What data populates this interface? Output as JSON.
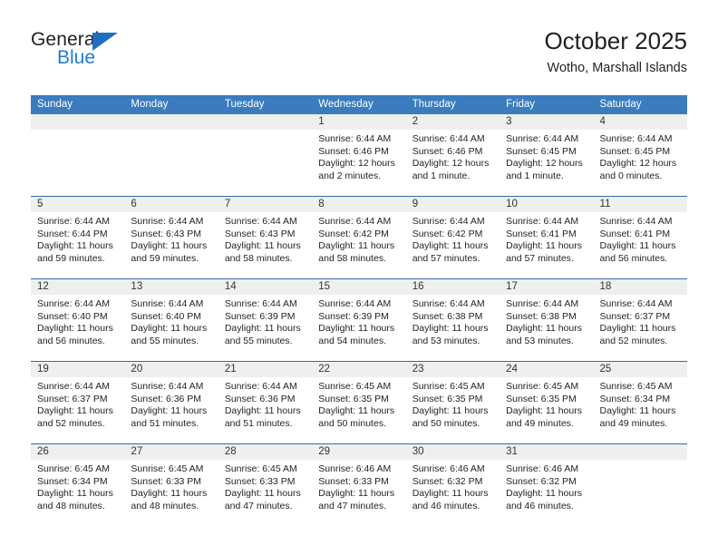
{
  "brand": {
    "name_top": "General",
    "name_bottom": "Blue",
    "accent_color": "#1f7bd4"
  },
  "header": {
    "title": "October 2025",
    "subtitle": "Wotho, Marshall Islands"
  },
  "calendar": {
    "header_background": "#3a7cbe",
    "day_band_background": "#efefef",
    "row_border_color": "#2e6daf",
    "weekdays": [
      "Sunday",
      "Monday",
      "Tuesday",
      "Wednesday",
      "Thursday",
      "Friday",
      "Saturday"
    ],
    "labels": {
      "sunrise": "Sunrise:",
      "sunset": "Sunset:",
      "daylight": "Daylight:"
    },
    "weeks": [
      [
        {
          "day": "",
          "empty": true
        },
        {
          "day": "",
          "empty": true
        },
        {
          "day": "",
          "empty": true
        },
        {
          "day": "1",
          "sunrise": "Sunrise: 6:44 AM",
          "sunset": "Sunset: 6:46 PM",
          "daylight": "Daylight: 12 hours and 2 minutes."
        },
        {
          "day": "2",
          "sunrise": "Sunrise: 6:44 AM",
          "sunset": "Sunset: 6:46 PM",
          "daylight": "Daylight: 12 hours and 1 minute."
        },
        {
          "day": "3",
          "sunrise": "Sunrise: 6:44 AM",
          "sunset": "Sunset: 6:45 PM",
          "daylight": "Daylight: 12 hours and 1 minute."
        },
        {
          "day": "4",
          "sunrise": "Sunrise: 6:44 AM",
          "sunset": "Sunset: 6:45 PM",
          "daylight": "Daylight: 12 hours and 0 minutes."
        }
      ],
      [
        {
          "day": "5",
          "sunrise": "Sunrise: 6:44 AM",
          "sunset": "Sunset: 6:44 PM",
          "daylight": "Daylight: 11 hours and 59 minutes."
        },
        {
          "day": "6",
          "sunrise": "Sunrise: 6:44 AM",
          "sunset": "Sunset: 6:43 PM",
          "daylight": "Daylight: 11 hours and 59 minutes."
        },
        {
          "day": "7",
          "sunrise": "Sunrise: 6:44 AM",
          "sunset": "Sunset: 6:43 PM",
          "daylight": "Daylight: 11 hours and 58 minutes."
        },
        {
          "day": "8",
          "sunrise": "Sunrise: 6:44 AM",
          "sunset": "Sunset: 6:42 PM",
          "daylight": "Daylight: 11 hours and 58 minutes."
        },
        {
          "day": "9",
          "sunrise": "Sunrise: 6:44 AM",
          "sunset": "Sunset: 6:42 PM",
          "daylight": "Daylight: 11 hours and 57 minutes."
        },
        {
          "day": "10",
          "sunrise": "Sunrise: 6:44 AM",
          "sunset": "Sunset: 6:41 PM",
          "daylight": "Daylight: 11 hours and 57 minutes."
        },
        {
          "day": "11",
          "sunrise": "Sunrise: 6:44 AM",
          "sunset": "Sunset: 6:41 PM",
          "daylight": "Daylight: 11 hours and 56 minutes."
        }
      ],
      [
        {
          "day": "12",
          "sunrise": "Sunrise: 6:44 AM",
          "sunset": "Sunset: 6:40 PM",
          "daylight": "Daylight: 11 hours and 56 minutes."
        },
        {
          "day": "13",
          "sunrise": "Sunrise: 6:44 AM",
          "sunset": "Sunset: 6:40 PM",
          "daylight": "Daylight: 11 hours and 55 minutes."
        },
        {
          "day": "14",
          "sunrise": "Sunrise: 6:44 AM",
          "sunset": "Sunset: 6:39 PM",
          "daylight": "Daylight: 11 hours and 55 minutes."
        },
        {
          "day": "15",
          "sunrise": "Sunrise: 6:44 AM",
          "sunset": "Sunset: 6:39 PM",
          "daylight": "Daylight: 11 hours and 54 minutes."
        },
        {
          "day": "16",
          "sunrise": "Sunrise: 6:44 AM",
          "sunset": "Sunset: 6:38 PM",
          "daylight": "Daylight: 11 hours and 53 minutes."
        },
        {
          "day": "17",
          "sunrise": "Sunrise: 6:44 AM",
          "sunset": "Sunset: 6:38 PM",
          "daylight": "Daylight: 11 hours and 53 minutes."
        },
        {
          "day": "18",
          "sunrise": "Sunrise: 6:44 AM",
          "sunset": "Sunset: 6:37 PM",
          "daylight": "Daylight: 11 hours and 52 minutes."
        }
      ],
      [
        {
          "day": "19",
          "sunrise": "Sunrise: 6:44 AM",
          "sunset": "Sunset: 6:37 PM",
          "daylight": "Daylight: 11 hours and 52 minutes."
        },
        {
          "day": "20",
          "sunrise": "Sunrise: 6:44 AM",
          "sunset": "Sunset: 6:36 PM",
          "daylight": "Daylight: 11 hours and 51 minutes."
        },
        {
          "day": "21",
          "sunrise": "Sunrise: 6:44 AM",
          "sunset": "Sunset: 6:36 PM",
          "daylight": "Daylight: 11 hours and 51 minutes."
        },
        {
          "day": "22",
          "sunrise": "Sunrise: 6:45 AM",
          "sunset": "Sunset: 6:35 PM",
          "daylight": "Daylight: 11 hours and 50 minutes."
        },
        {
          "day": "23",
          "sunrise": "Sunrise: 6:45 AM",
          "sunset": "Sunset: 6:35 PM",
          "daylight": "Daylight: 11 hours and 50 minutes."
        },
        {
          "day": "24",
          "sunrise": "Sunrise: 6:45 AM",
          "sunset": "Sunset: 6:35 PM",
          "daylight": "Daylight: 11 hours and 49 minutes."
        },
        {
          "day": "25",
          "sunrise": "Sunrise: 6:45 AM",
          "sunset": "Sunset: 6:34 PM",
          "daylight": "Daylight: 11 hours and 49 minutes."
        }
      ],
      [
        {
          "day": "26",
          "sunrise": "Sunrise: 6:45 AM",
          "sunset": "Sunset: 6:34 PM",
          "daylight": "Daylight: 11 hours and 48 minutes."
        },
        {
          "day": "27",
          "sunrise": "Sunrise: 6:45 AM",
          "sunset": "Sunset: 6:33 PM",
          "daylight": "Daylight: 11 hours and 48 minutes."
        },
        {
          "day": "28",
          "sunrise": "Sunrise: 6:45 AM",
          "sunset": "Sunset: 6:33 PM",
          "daylight": "Daylight: 11 hours and 47 minutes."
        },
        {
          "day": "29",
          "sunrise": "Sunrise: 6:46 AM",
          "sunset": "Sunset: 6:33 PM",
          "daylight": "Daylight: 11 hours and 47 minutes."
        },
        {
          "day": "30",
          "sunrise": "Sunrise: 6:46 AM",
          "sunset": "Sunset: 6:32 PM",
          "daylight": "Daylight: 11 hours and 46 minutes."
        },
        {
          "day": "31",
          "sunrise": "Sunrise: 6:46 AM",
          "sunset": "Sunset: 6:32 PM",
          "daylight": "Daylight: 11 hours and 46 minutes."
        },
        {
          "day": "",
          "empty": true
        }
      ]
    ]
  }
}
